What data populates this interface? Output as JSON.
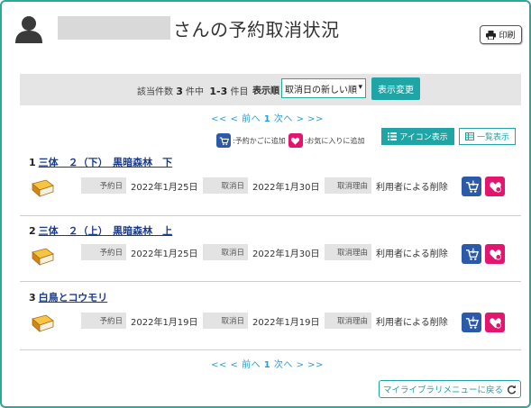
{
  "header": {
    "title": "さんの予約取消状況",
    "print_label": "印刷"
  },
  "search": {
    "count_prefix": "該当件数",
    "count_total": "3",
    "count_mid": "件中",
    "count_range": "1-3",
    "count_suffix": "件目",
    "sort_label": "表示順",
    "sort_value": "取消日の新しい順",
    "apply_label": "表示変更"
  },
  "pager": {
    "first": "<<",
    "prev": "< 前へ",
    "current": "1",
    "next": "次へ >",
    "last": ">>"
  },
  "legend": {
    "cart_text": ":予約かごに追加",
    "fav_text": ":お気に入りに追加",
    "icon_view_label": "アイコン表示",
    "list_view_label": "一覧表示"
  },
  "labels": {
    "reserve_date": "予約日",
    "cancel_date": "取消日",
    "cancel_reason": "取消理由"
  },
  "items": [
    {
      "num": "1",
      "title": "三体　２（下）　黒暗森林　下",
      "reserve_date": "2022年1月25日",
      "cancel_date": "2022年1月30日",
      "reason": "利用者による削除"
    },
    {
      "num": "2",
      "title": "三体　２（上）　黒暗森林　上",
      "reserve_date": "2022年1月25日",
      "cancel_date": "2022年1月30日",
      "reason": "利用者による削除"
    },
    {
      "num": "3",
      "title": "白鳥とコウモリ",
      "reserve_date": "2022年1月19日",
      "cancel_date": "2022年1月19日",
      "reason": "利用者による削除"
    }
  ],
  "footer": {
    "back_label": "マイライブラリメニューに戻る"
  },
  "colors": {
    "accent": "#1fa5a5",
    "link": "#1a3c8f",
    "cart": "#2a5aa8",
    "favorite": "#e2166e"
  }
}
